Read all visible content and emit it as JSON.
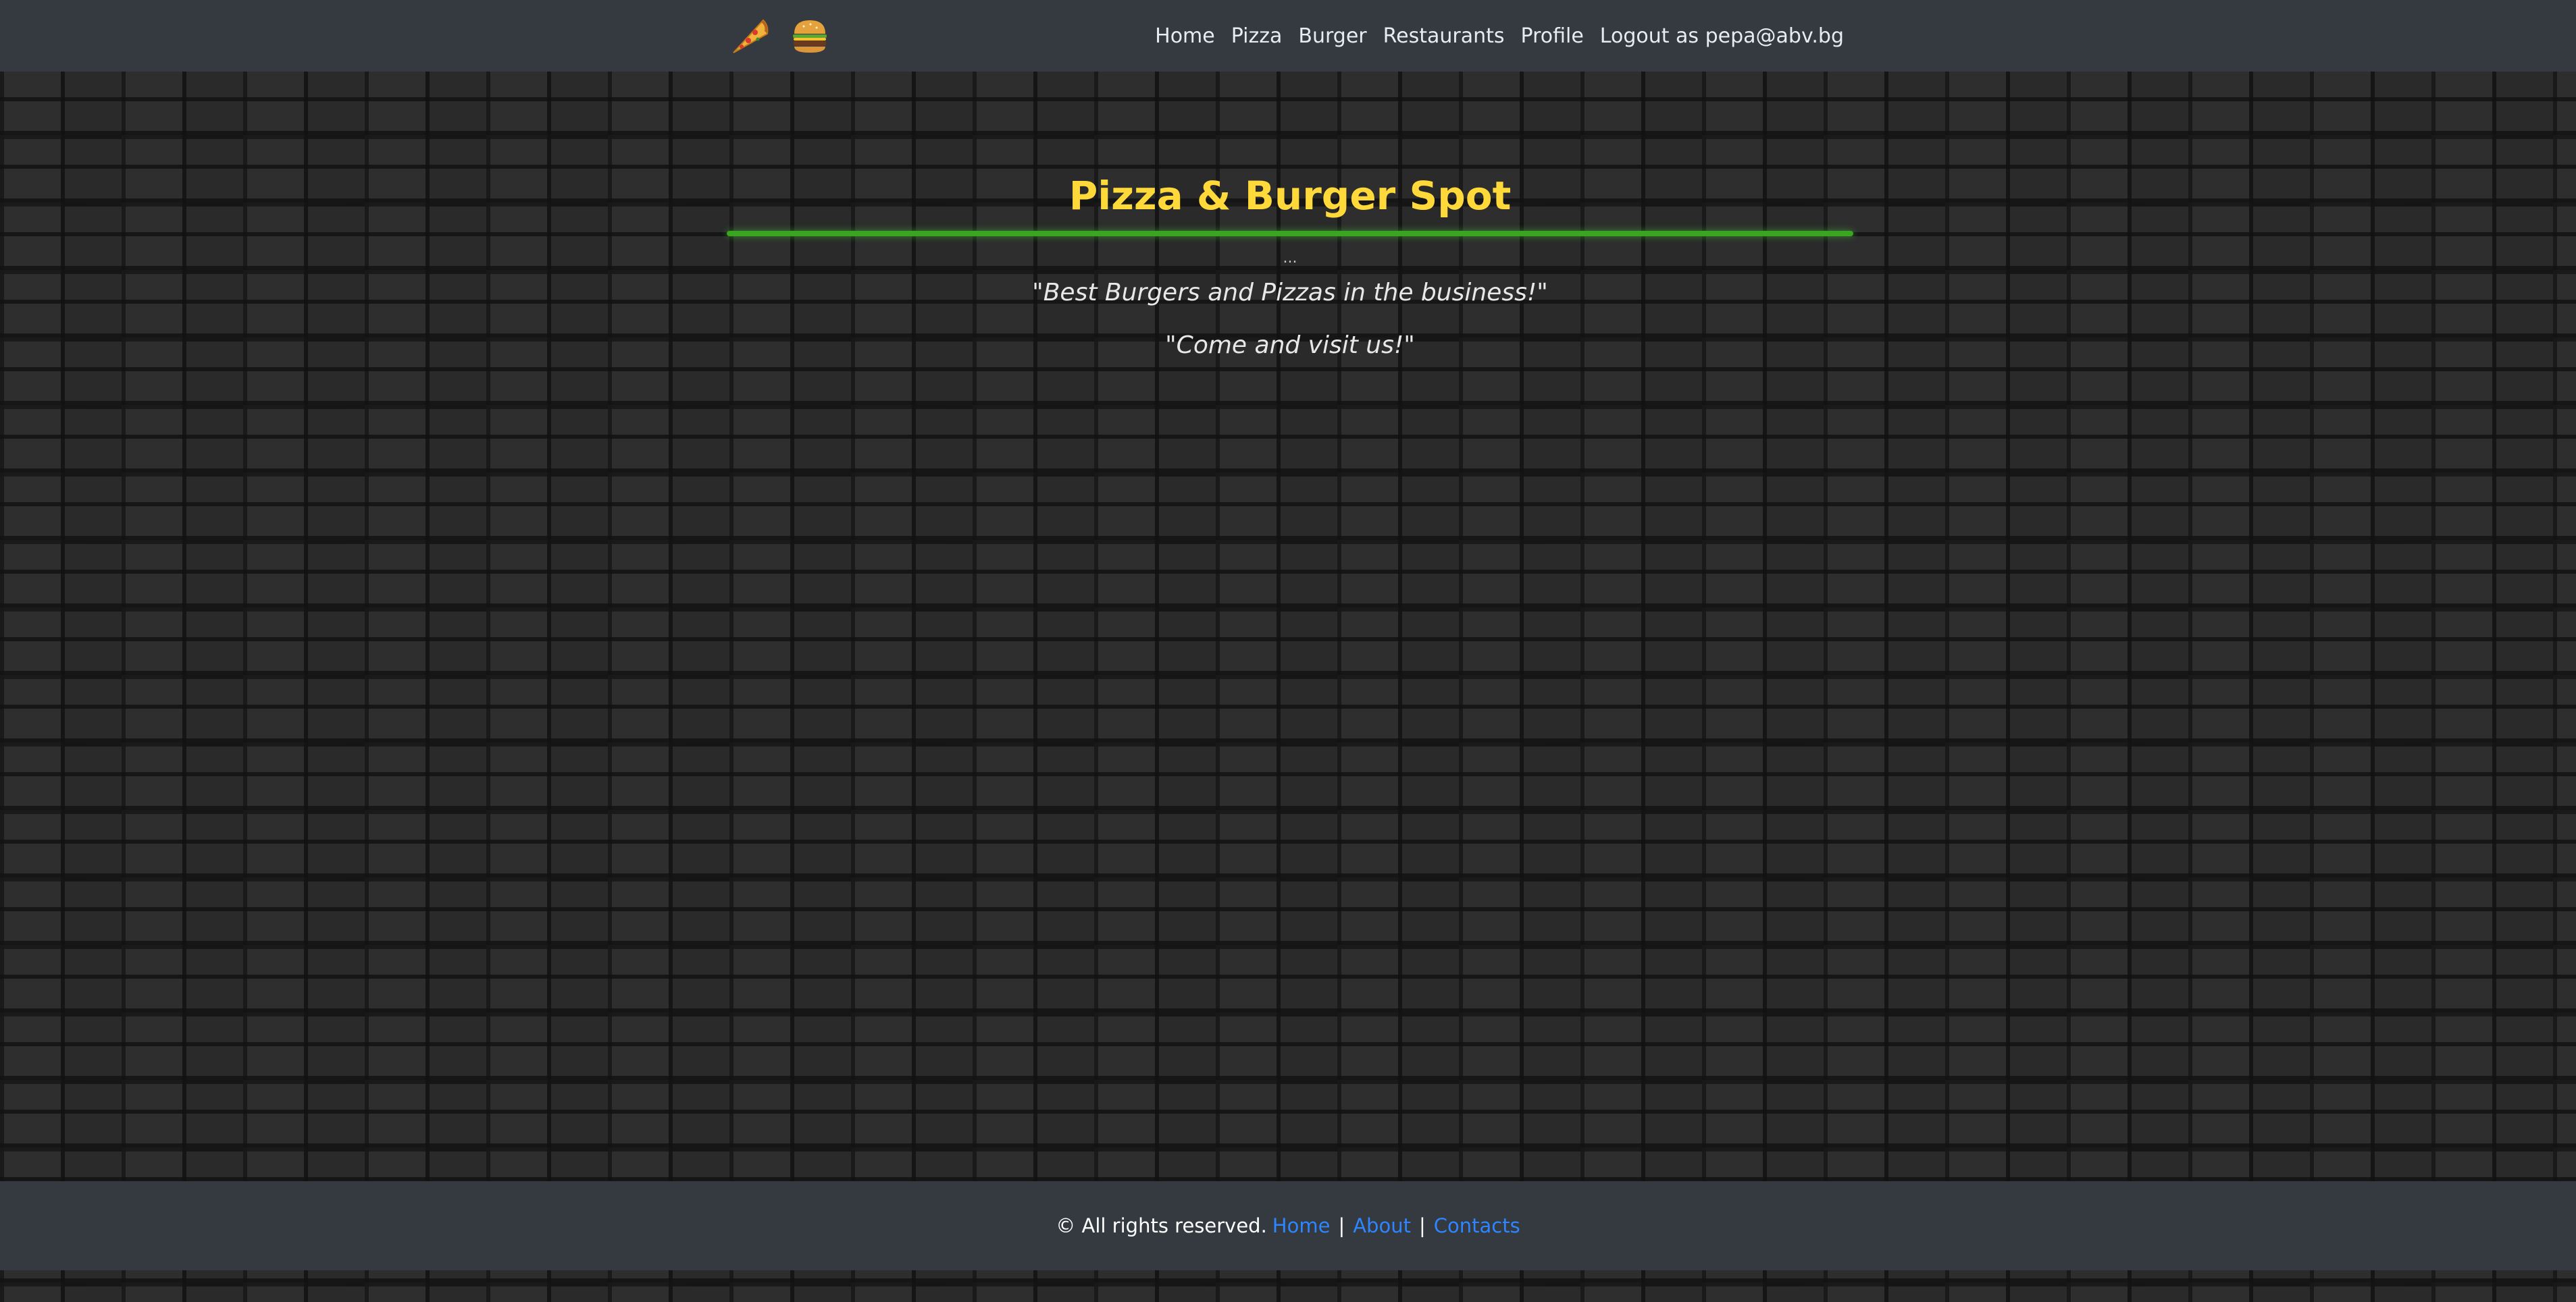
{
  "navbar": {
    "icons": [
      "pizza-slice-icon",
      "burger-icon"
    ],
    "links": [
      "Home",
      "Pizza",
      "Burger",
      "Restaurants",
      "Profile",
      "Logout as pepa@abv.bg"
    ]
  },
  "main": {
    "title": "Pizza & Burger Spot",
    "dots": "...",
    "taglines": [
      "\"Best Burgers and Pizzas in the business!\"",
      "\"Come and visit us!\""
    ]
  },
  "footer": {
    "copyright": "© All rights reserved.",
    "links": [
      "Home",
      "About",
      "Contacts"
    ],
    "separator": "|"
  },
  "colors": {
    "navbar_bg": "#343a40",
    "title": "#ffd83a",
    "rule": "#3aa520",
    "footer_link": "#2e86ff",
    "background": "#2b2b2c"
  }
}
